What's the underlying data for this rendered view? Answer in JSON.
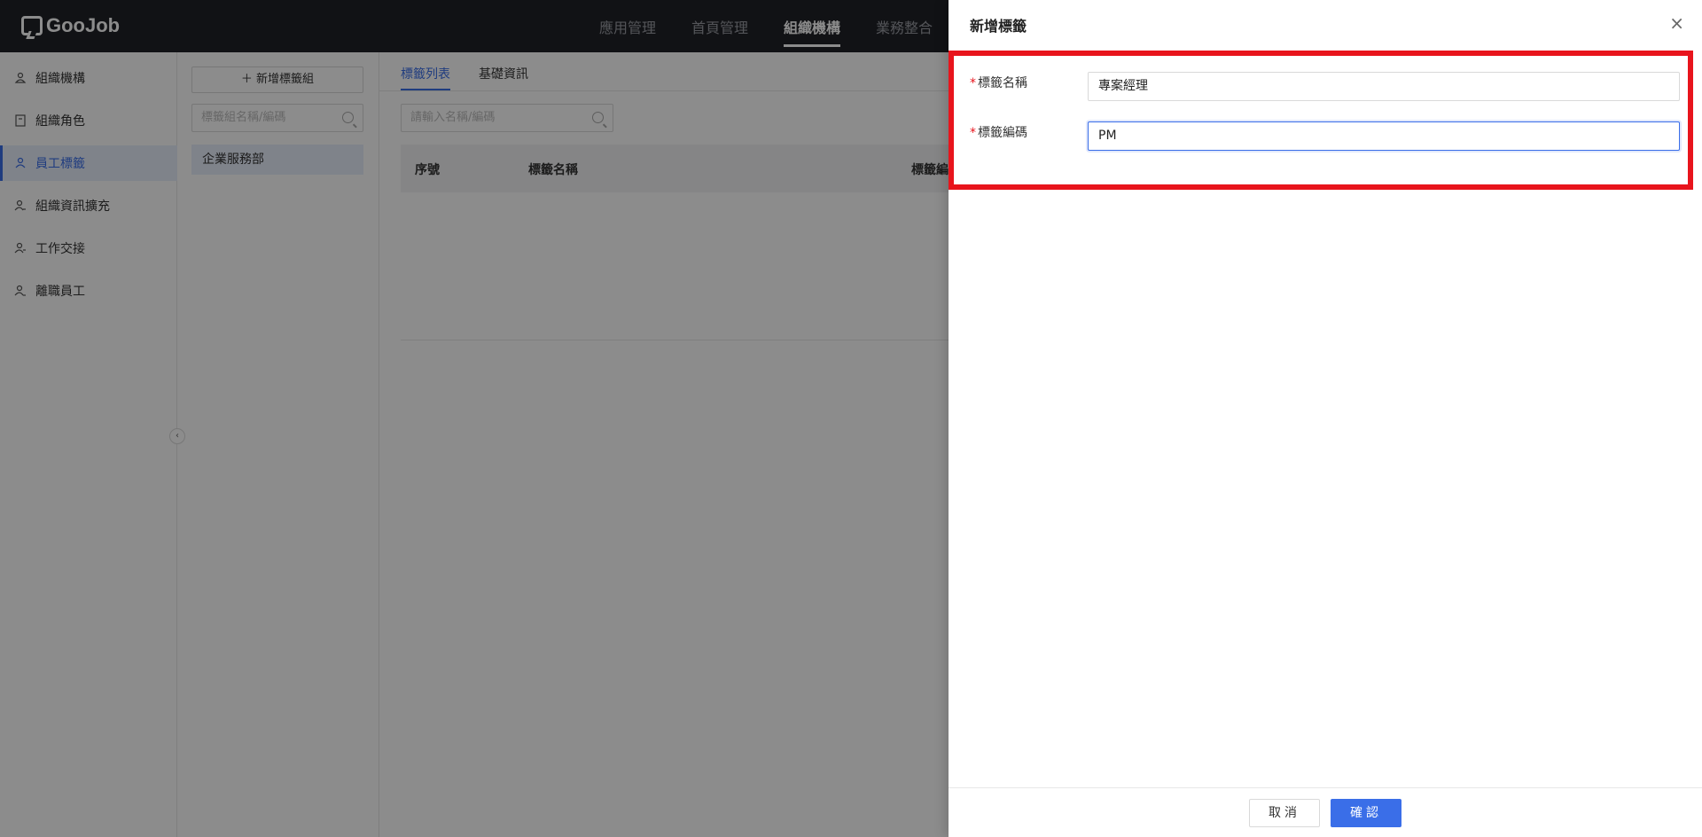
{
  "app": {
    "logo": "GooJob"
  },
  "topnav": {
    "items": [
      "應用管理",
      "首頁管理",
      "組織機構",
      "業務整合"
    ],
    "active_index": 2
  },
  "sidebar": {
    "items": [
      {
        "label": "組織機構",
        "icon": "org-icon"
      },
      {
        "label": "組織角色",
        "icon": "role-icon"
      },
      {
        "label": "員工標籤",
        "icon": "tag-user-icon"
      },
      {
        "label": "組織資訊擴充",
        "icon": "user-extend-icon"
      },
      {
        "label": "工作交接",
        "icon": "handover-icon"
      },
      {
        "label": "離職員工",
        "icon": "resigned-icon"
      }
    ],
    "active_index": 2
  },
  "groups": {
    "add_button": "＋ 新增標籤組",
    "search_placeholder": "標籤組名稱/編碼",
    "items": [
      "企業服務部"
    ]
  },
  "main": {
    "tabs": [
      "標籤列表",
      "基礎資訊"
    ],
    "active_tab": 0,
    "search_placeholder": "請輸入名稱/編碼",
    "columns": [
      "序號",
      "標籤名稱",
      "標籤編"
    ]
  },
  "drawer": {
    "title": "新增標籤",
    "close": "×",
    "fields": [
      {
        "label": "標籤名稱",
        "required": "*",
        "value": "專案經理"
      },
      {
        "label": "標籤編碼",
        "required": "*",
        "value": "PM"
      }
    ],
    "cancel_label": "取消",
    "ok_label": "確認"
  },
  "colors": {
    "accent": "#3a6ee8",
    "highlight": "#e8141c",
    "topbar": "#1f2127"
  }
}
